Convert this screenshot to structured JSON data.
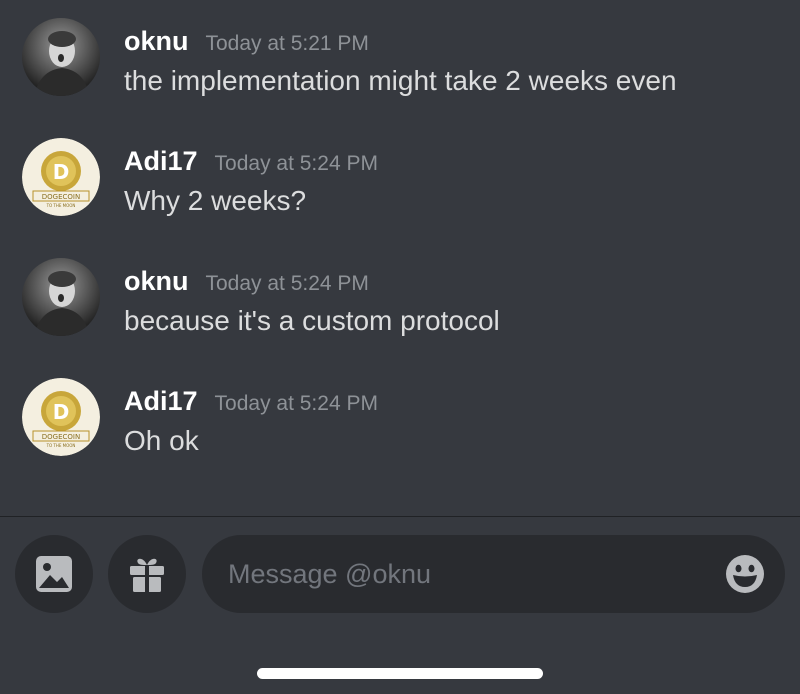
{
  "messages": [
    {
      "username": "oknu",
      "timestamp": "Today at 5:21 PM",
      "text": "the implementation might take 2 weeks even",
      "avatar": "user-photo-avatar"
    },
    {
      "username": "Adi17",
      "timestamp": "Today at 5:24 PM",
      "text": "Why 2 weeks?",
      "avatar": "dogecoin-avatar"
    },
    {
      "username": "oknu",
      "timestamp": "Today at 5:24 PM",
      "text": "because it's a custom protocol",
      "avatar": "user-photo-avatar"
    },
    {
      "username": "Adi17",
      "timestamp": "Today at 5:24 PM",
      "text": "Oh ok",
      "avatar": "dogecoin-avatar"
    }
  ],
  "dogecoin_logo": {
    "top_text": "DOGECOIN",
    "bottom_text": "TO THE MOON"
  },
  "composer": {
    "placeholder": "Message @oknu",
    "attach_icon": "image-icon",
    "gift_icon": "gift-icon",
    "emoji_icon": "emoji-icon"
  },
  "colors": {
    "background": "#36393f",
    "input_background": "#292b2f",
    "username": "#ffffff",
    "timestamp": "#8e9297",
    "message_text": "#dcddde",
    "placeholder": "#72767d",
    "icon": "#b9bbbe"
  }
}
